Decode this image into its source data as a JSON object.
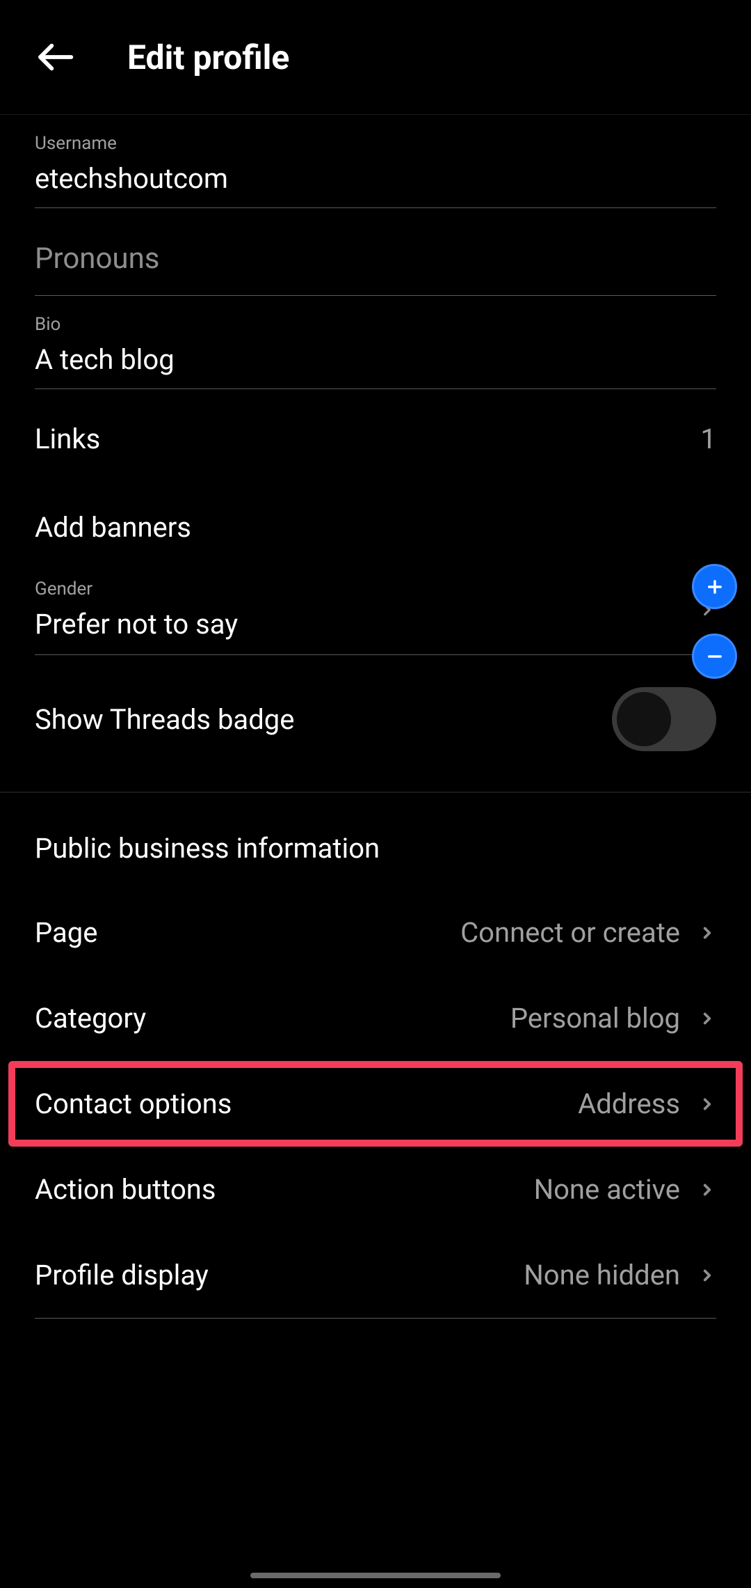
{
  "header": {
    "title": "Edit profile"
  },
  "fields": {
    "username_label": "Username",
    "username_value": "etechshoutcom",
    "pronouns_label": "Pronouns",
    "pronouns_value": "",
    "bio_label": "Bio",
    "bio_value": "A tech blog",
    "links_label": "Links",
    "links_count": "1",
    "banners_label": "Add banners",
    "gender_label": "Gender",
    "gender_value": "Prefer not to say",
    "threads_label": "Show Threads badge"
  },
  "business": {
    "section_title": "Public business information",
    "page_label": "Page",
    "page_value": "Connect or create",
    "category_label": "Category",
    "category_value": "Personal blog",
    "contact_label": "Contact options",
    "contact_value": "Address",
    "action_label": "Action buttons",
    "action_value": "None active",
    "display_label": "Profile display",
    "display_value": "None hidden"
  }
}
